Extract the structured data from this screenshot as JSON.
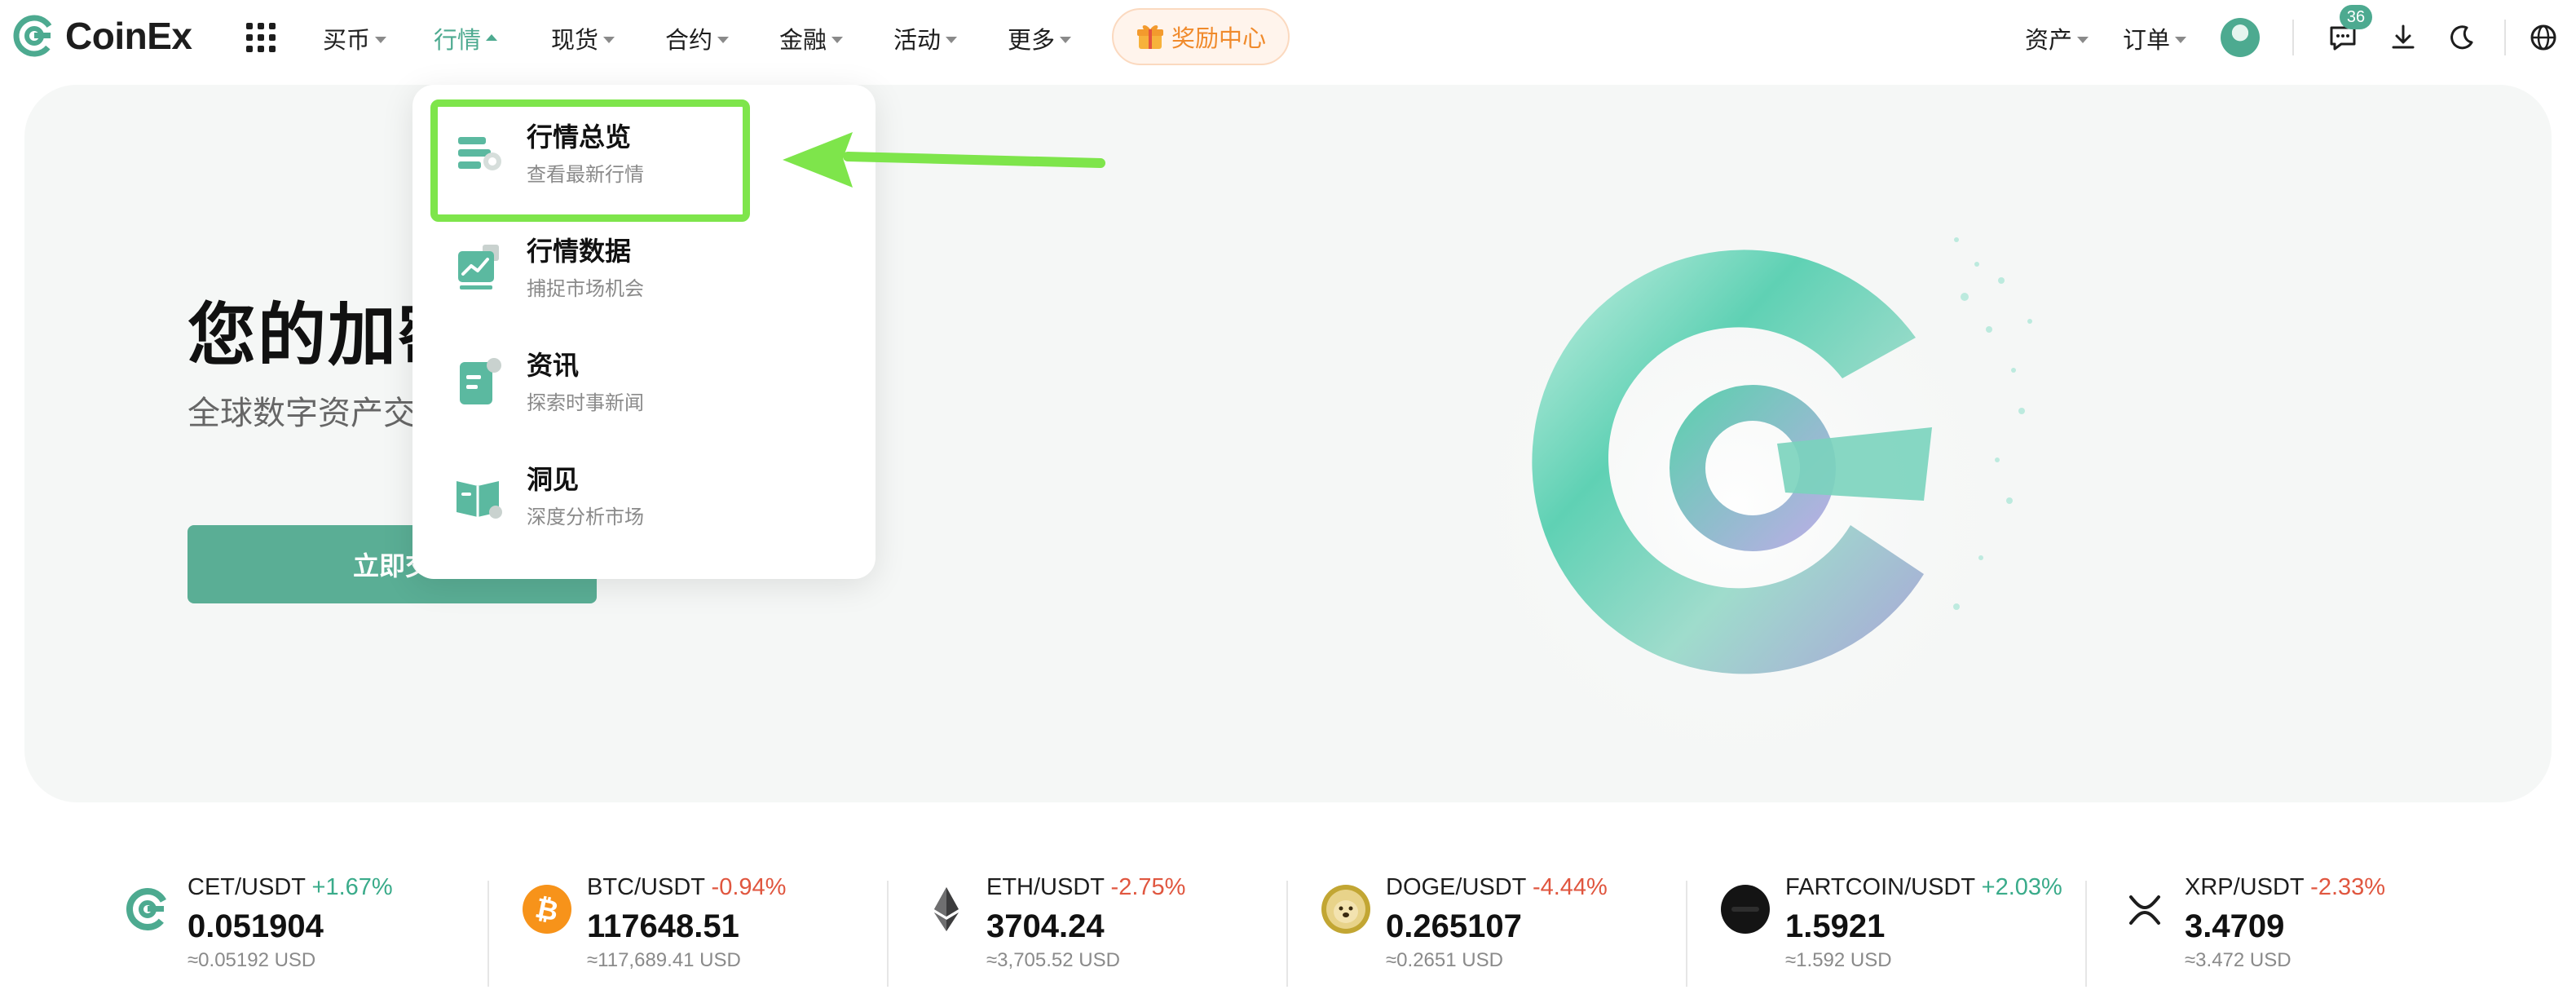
{
  "nav": {
    "brand": "CoinEx",
    "items": [
      {
        "label": "买币"
      },
      {
        "label": "行情"
      },
      {
        "label": "现货"
      },
      {
        "label": "合约"
      },
      {
        "label": "金融"
      },
      {
        "label": "活动"
      },
      {
        "label": "更多"
      }
    ],
    "reward_label": "奖励中心",
    "assets_label": "资产",
    "orders_label": "订单",
    "message_count": "36"
  },
  "colors": {
    "brand": "#4daa90",
    "up": "#3aab8a",
    "down": "#e0563f",
    "highlight": "#7ee54b"
  },
  "hero": {
    "title": "您的加密",
    "subtitle": "全球数字资产交",
    "cta_label": "立即交"
  },
  "dropdown": {
    "items": [
      {
        "title": "行情总览",
        "desc": "查看最新行情",
        "icon": "market-overview-icon"
      },
      {
        "title": "行情数据",
        "desc": "捕捉市场机会",
        "icon": "market-data-icon"
      },
      {
        "title": "资讯",
        "desc": "探索时事新闻",
        "icon": "news-icon"
      },
      {
        "title": "洞见",
        "desc": "深度分析市场",
        "icon": "insights-icon"
      }
    ]
  },
  "ticker": [
    {
      "pair": "CET/USDT",
      "change": "+1.67%",
      "direction": "up",
      "price": "0.051904",
      "usd": "≈0.05192 USD",
      "icon": "cet-coin-icon"
    },
    {
      "pair": "BTC/USDT",
      "change": "-0.94%",
      "direction": "down",
      "price": "117648.51",
      "usd": "≈117,689.41 USD",
      "icon": "btc-coin-icon"
    },
    {
      "pair": "ETH/USDT",
      "change": "-2.75%",
      "direction": "down",
      "price": "3704.24",
      "usd": "≈3,705.52 USD",
      "icon": "eth-coin-icon"
    },
    {
      "pair": "DOGE/USDT",
      "change": "-4.44%",
      "direction": "down",
      "price": "0.265107",
      "usd": "≈0.2651 USD",
      "icon": "doge-coin-icon"
    },
    {
      "pair": "FARTCOIN/USDT",
      "change": "+2.03%",
      "direction": "up",
      "price": "1.5921",
      "usd": "≈1.592 USD",
      "icon": "fartcoin-coin-icon"
    },
    {
      "pair": "XRP/USDT",
      "change": "-2.33%",
      "direction": "down",
      "price": "3.4709",
      "usd": "≈3.472 USD",
      "icon": "xrp-coin-icon"
    }
  ]
}
